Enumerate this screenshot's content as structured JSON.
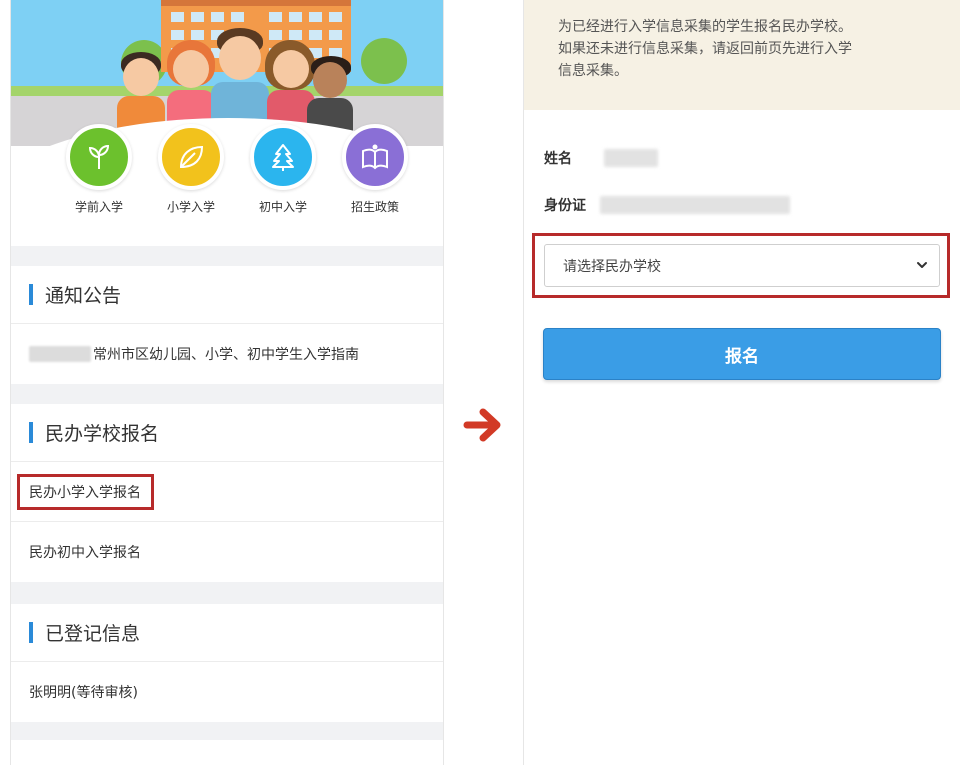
{
  "left": {
    "categories": [
      {
        "label": "学前入学",
        "color": "#6cc12d",
        "icon": "sprout-icon"
      },
      {
        "label": "小学入学",
        "color": "#f2c21c",
        "icon": "leaf-icon"
      },
      {
        "label": "初中入学",
        "color": "#2bb5ee",
        "icon": "tree-icon"
      },
      {
        "label": "招生政策",
        "color": "#8a6fd6",
        "icon": "book-icon"
      }
    ],
    "notice": {
      "title": "通知公告",
      "item": "常州市区幼儿园、小学、初中学生入学指南"
    },
    "private": {
      "title": "民办学校报名",
      "items": [
        "民办小学入学报名",
        "民办初中入学报名"
      ]
    },
    "registered": {
      "title": "已登记信息",
      "item": "张明明(等待审核)"
    }
  },
  "right": {
    "notice_lines": [
      "为已经进行入学信息采集的学生报名民办学校。",
      "如果还未进行信息采集，请返回前页先进行入学",
      "信息采集。"
    ],
    "name_label": "姓名",
    "id_label": "身份证",
    "select_placeholder": "请选择民办学校",
    "submit_label": "报名"
  },
  "colors": {
    "accent_blue": "#3a9de6",
    "highlight_red": "#b72a2a",
    "arrow_red": "#d23a26"
  }
}
